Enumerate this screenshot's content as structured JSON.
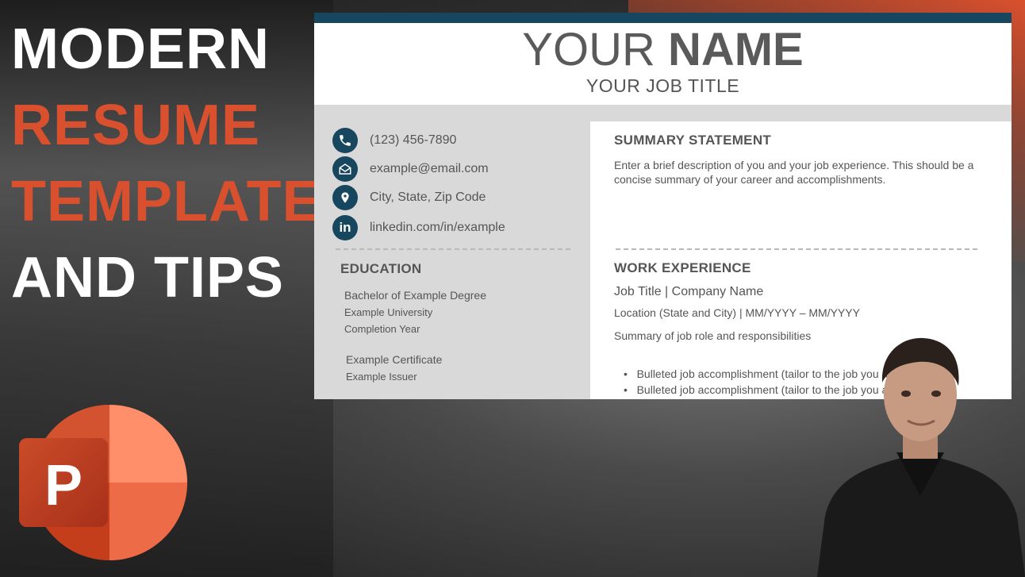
{
  "headline": {
    "line1": "MODERN",
    "line2": "RESUME",
    "line3": "TEMPLATE",
    "line4": "AND TIPS"
  },
  "colors": {
    "accent_orange": "#d9502e",
    "resume_navy": "#17475e",
    "panel_gray": "#d9d9d9"
  },
  "resume": {
    "name_light": "YOUR ",
    "name_bold": "NAME",
    "job_title": "YOUR JOB TITLE",
    "contact": [
      {
        "icon": "phone-icon",
        "text": "(123) 456-7890"
      },
      {
        "icon": "email-icon",
        "text": "example@email.com"
      },
      {
        "icon": "location-pin-icon",
        "text": "City, State, Zip Code"
      },
      {
        "icon": "linkedin-icon",
        "text": "linkedin.com/in/example"
      }
    ],
    "education": {
      "title": "EDUCATION",
      "degree": "Bachelor of Example Degree",
      "university": "Example University",
      "year": "Completion Year",
      "certificate": "Example Certificate",
      "issuer": "Example Issuer"
    },
    "summary": {
      "title": "SUMMARY STATEMENT",
      "text": "Enter a brief description of you and your job experience. This should be a concise summary of your career and accomplishments."
    },
    "work": {
      "title": "WORK EXPERIENCE",
      "job": "Job Title | Company Name",
      "location": "Location (State and City) | MM/YYYY – MM/YYYY",
      "role": "Summary of job role and responsibilities",
      "bullets": [
        "Bulleted job accomplishment (tailor to the job you apply to)",
        "Bulleted job accomplishment (tailor to the job you apply to)"
      ]
    }
  },
  "logo": {
    "letter": "P",
    "icon": "powerpoint-logo-icon"
  }
}
